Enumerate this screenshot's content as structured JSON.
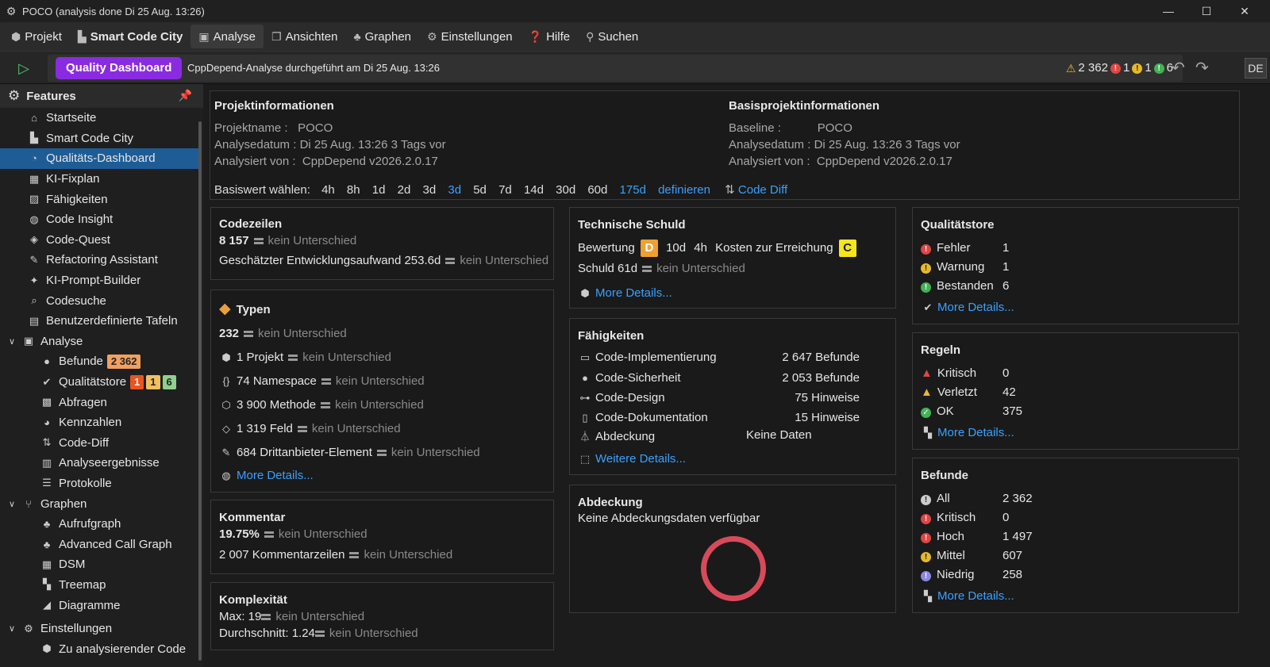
{
  "window": {
    "title": "POCO (analysis done Di 25 Aug.  13:26)"
  },
  "menu": [
    {
      "label": "Projekt",
      "icon": "cube-icon"
    },
    {
      "label": "Smart Code City",
      "icon": "city-icon"
    },
    {
      "label": "Analyse",
      "icon": "analysis-icon"
    },
    {
      "label": "Ansichten",
      "icon": "windows-icon"
    },
    {
      "label": "Graphen",
      "icon": "graph-icon"
    },
    {
      "label": "Einstellungen",
      "icon": "gear-icon"
    },
    {
      "label": "Hilfe",
      "icon": "help-icon"
    },
    {
      "label": "Suchen",
      "icon": "search-icon"
    }
  ],
  "toolbar": {
    "tab_label": "Quality Dashboard",
    "description": "CppDepend-Analyse durchgeführt am Di 25 Aug.  13:26",
    "warnings": "2 362",
    "errors": "1",
    "yellow": "1",
    "passed": "6",
    "lang": "DE"
  },
  "sidebar": {
    "title": "Features",
    "items": [
      {
        "label": "Startseite"
      },
      {
        "label": "Smart Code City"
      },
      {
        "label": "Qualitäts-Dashboard"
      },
      {
        "label": "KI-Fixplan"
      },
      {
        "label": "Fähigkeiten"
      },
      {
        "label": "Code Insight"
      },
      {
        "label": "Code-Quest"
      },
      {
        "label": "Refactoring Assistant"
      },
      {
        "label": "KI-Prompt-Builder"
      },
      {
        "label": "Codesuche"
      },
      {
        "label": "Benutzerdefinierte Tafeln"
      },
      {
        "label": "Analyse"
      },
      {
        "label": "Befunde",
        "badge": "2 362"
      },
      {
        "label": "Qualitätstore",
        "badges": [
          "1",
          "1",
          "6"
        ]
      },
      {
        "label": "Abfragen"
      },
      {
        "label": "Kennzahlen"
      },
      {
        "label": "Code-Diff"
      },
      {
        "label": "Analyseergebnisse"
      },
      {
        "label": "Protokolle"
      },
      {
        "label": "Graphen"
      },
      {
        "label": "Aufrufgraph"
      },
      {
        "label": "Advanced Call Graph"
      },
      {
        "label": "DSM"
      },
      {
        "label": "Treemap"
      },
      {
        "label": "Diagramme"
      },
      {
        "label": "Einstellungen"
      },
      {
        "label": "Zu analysierender Code"
      }
    ]
  },
  "project": {
    "title": "Projektinformationen",
    "name_label": "Projektname :",
    "name": "POCO",
    "date_label": "Analysedatum :",
    "date": "Di 25 Aug.  13:26 3 Tags vor",
    "by_label": "Analysiert von :",
    "by": "CppDepend v2026.2.0.17"
  },
  "baseline": {
    "title": "Basisprojektinformationen",
    "name_label": "Baseline :",
    "name": "POCO",
    "date_label": "Analysedatum :",
    "date": "Di 25 Aug.  13:26 3 Tags vor",
    "by_label": "Analysiert von :",
    "by": "CppDepend v2026.2.0.17"
  },
  "basis": {
    "label": "Basiswert wählen:",
    "options": [
      "4h",
      "8h",
      "1d",
      "2d",
      "3d",
      "3d",
      "5d",
      "7d",
      "14d",
      "30d",
      "60d",
      "175d",
      "definieren"
    ],
    "code_diff": "Code Diff"
  },
  "codezeilen": {
    "title": "Codezeilen",
    "value": "8 157",
    "diff": "kein Unterschied",
    "effort": "Geschätzter Entwicklungsaufwand 253.6d",
    "effort_diff": "kein Unterschied"
  },
  "typen": {
    "title": "Typen",
    "value": "232",
    "diff": "kein Unterschied",
    "rows": [
      {
        "text": "1 Projekt",
        "diff": "kein Unterschied"
      },
      {
        "text": "74 Namespace",
        "diff": "kein Unterschied"
      },
      {
        "text": "3 900 Methode",
        "diff": "kein Unterschied"
      },
      {
        "text": "1 319 Feld",
        "diff": "kein Unterschied"
      },
      {
        "text": "684 Drittanbieter-Element",
        "diff": "kein Unterschied"
      }
    ],
    "more": "More Details..."
  },
  "kommentar": {
    "title": "Kommentar",
    "value": "19.75%",
    "diff": "kein Unterschied",
    "lines": "2 007 Kommentarzeilen",
    "lines_diff": "kein Unterschied"
  },
  "komplex": {
    "title": "Komplexität",
    "max": "Max: 19",
    "max_diff": "kein Unterschied",
    "avg": "Durchschnitt: 1.24",
    "avg_diff": "kein Unterschied"
  },
  "debt": {
    "title": "Technische Schuld",
    "rating_label": "Bewertung",
    "rating": "D",
    "rating_color": "#f0a030",
    "time": "10d",
    "time2": "4h",
    "cost_label": "Kosten zur Erreichung",
    "target": "C",
    "target_color": "#f5e61a",
    "schuld": "Schuld 61d",
    "diff": "kein Unterschied",
    "more": "More Details..."
  },
  "faehigkeiten": {
    "title": "Fähigkeiten",
    "rows": [
      {
        "label": "Code-Implementierung",
        "value": "2 647 Befunde"
      },
      {
        "label": "Code-Sicherheit",
        "value": "2 053 Befunde"
      },
      {
        "label": "Code-Design",
        "value": "75 Hinweise"
      },
      {
        "label": "Code-Dokumentation",
        "value": "15 Hinweise"
      },
      {
        "label": "Abdeckung",
        "value": "Keine Daten"
      }
    ],
    "more": "Weitere Details..."
  },
  "abdeckung": {
    "title": "Abdeckung",
    "text": "Keine Abdeckungsdaten verfügbar"
  },
  "gates": {
    "title": "Qualitätstore",
    "rows": [
      {
        "label": "Fehler",
        "value": "1"
      },
      {
        "label": "Warnung",
        "value": "1"
      },
      {
        "label": "Bestanden",
        "value": "6"
      }
    ],
    "more": "More Details..."
  },
  "regeln": {
    "title": "Regeln",
    "rows": [
      {
        "label": "Kritisch",
        "value": "0"
      },
      {
        "label": "Verletzt",
        "value": "42"
      },
      {
        "label": "OK",
        "value": "375"
      }
    ],
    "more": "More Details..."
  },
  "befunde": {
    "title": "Befunde",
    "rows": [
      {
        "label": "All",
        "value": "2 362"
      },
      {
        "label": "Kritisch",
        "value": "0"
      },
      {
        "label": "Hoch",
        "value": "1 497"
      },
      {
        "label": "Mittel",
        "value": "607"
      },
      {
        "label": "Niedrig",
        "value": "258"
      }
    ],
    "more": "More Details..."
  }
}
